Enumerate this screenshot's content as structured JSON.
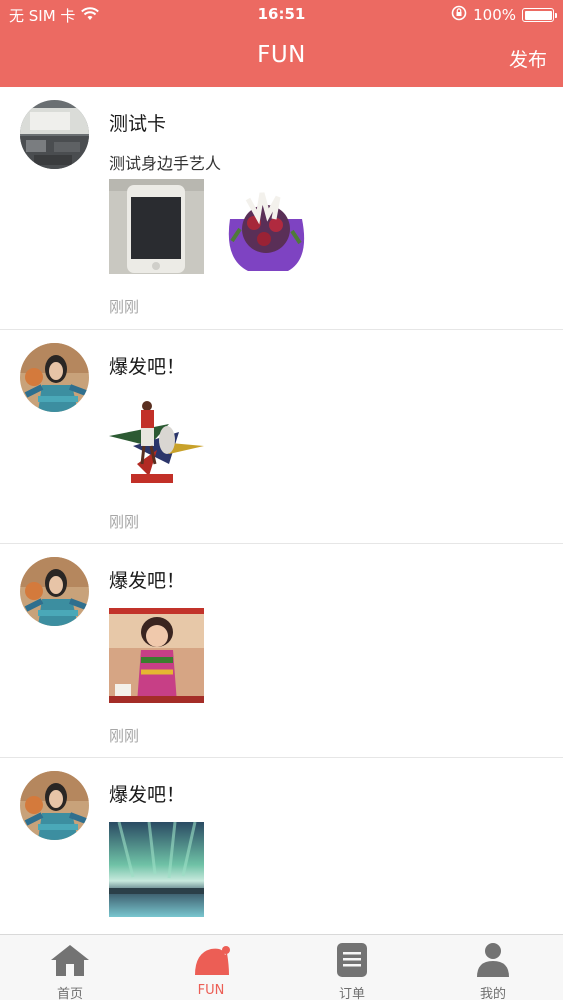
{
  "status_bar": {
    "carrier": "无 SIM 卡",
    "time": "16:51",
    "battery": "100%"
  },
  "header": {
    "title": "FUN",
    "publish_label": "发布"
  },
  "posts": [
    {
      "name": "测试卡",
      "text": "测试身边手艺人",
      "time": "刚刚"
    },
    {
      "name": "爆发吧！",
      "text": "",
      "time": "刚刚"
    },
    {
      "name": "爆发吧！",
      "text": "",
      "time": "刚刚"
    },
    {
      "name": "爆发吧！",
      "text": "",
      "time": ""
    }
  ],
  "tabbar": {
    "items": [
      {
        "label": "首页",
        "icon": "home-icon"
      },
      {
        "label": "FUN",
        "icon": "santa-hat-icon"
      },
      {
        "label": "订单",
        "icon": "order-icon"
      },
      {
        "label": "我的",
        "icon": "user-icon"
      }
    ],
    "active": "FUN"
  },
  "colors": {
    "brand": "#ec6a62",
    "active_tab": "#ec5e55",
    "time_gray": "#a7a7a7"
  }
}
